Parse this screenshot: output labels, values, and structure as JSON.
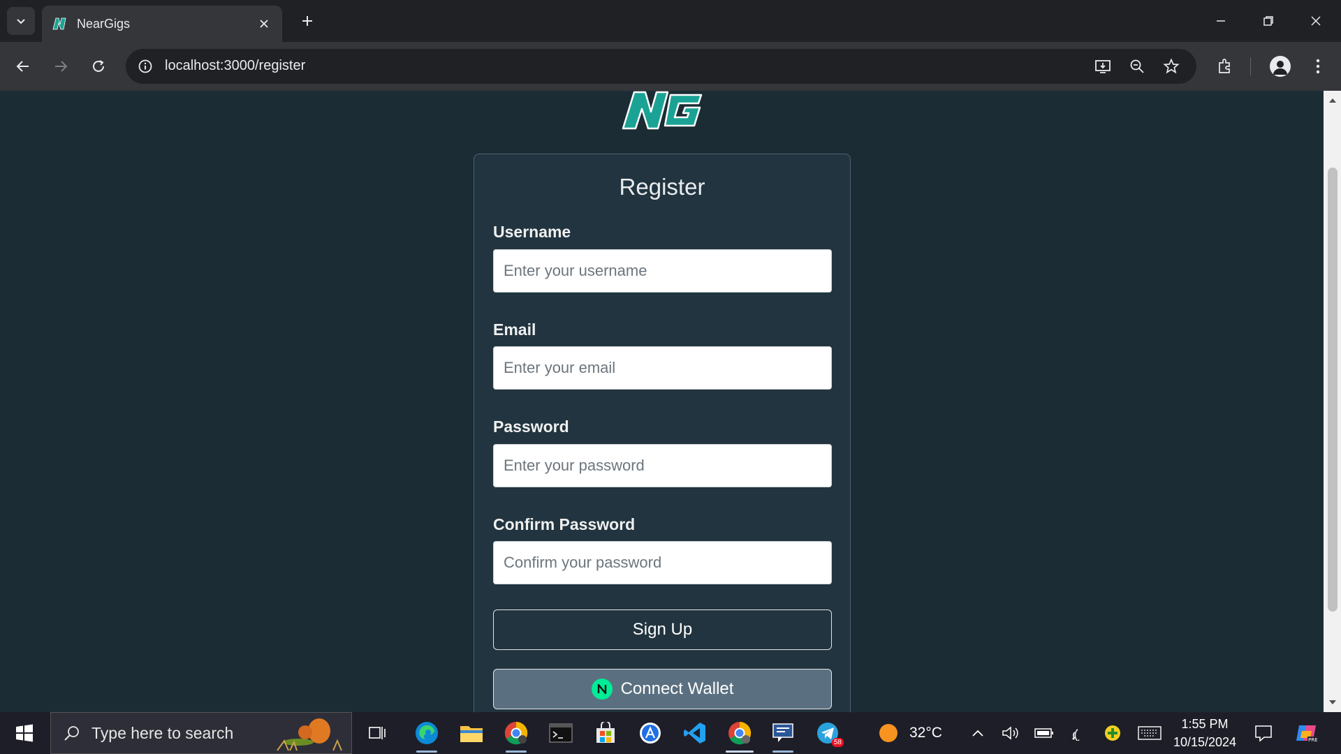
{
  "browser": {
    "tab_title": "NearGigs",
    "url": "localhost:3000/register"
  },
  "page": {
    "logo_text": "NG",
    "form": {
      "title": "Register",
      "username": {
        "label": "Username",
        "placeholder": "Enter your username"
      },
      "email": {
        "label": "Email",
        "placeholder": "Enter your email"
      },
      "password": {
        "label": "Password",
        "placeholder": "Enter your password"
      },
      "confirm_password": {
        "label": "Confirm Password",
        "placeholder": "Confirm your password"
      },
      "signup_label": "Sign Up",
      "wallet_label": "Connect Wallet"
    }
  },
  "taskbar": {
    "search_placeholder": "Type here to search",
    "weather": "32°C",
    "time": "1:55 PM",
    "date": "10/15/2024",
    "telegram_badge": "58"
  },
  "colors": {
    "page_bg": "#1b2c35",
    "card_bg": "#21343f",
    "logo_teal": "#1aa395",
    "wallet_button_bg": "#5a7080",
    "near_green": "#00ec97"
  }
}
